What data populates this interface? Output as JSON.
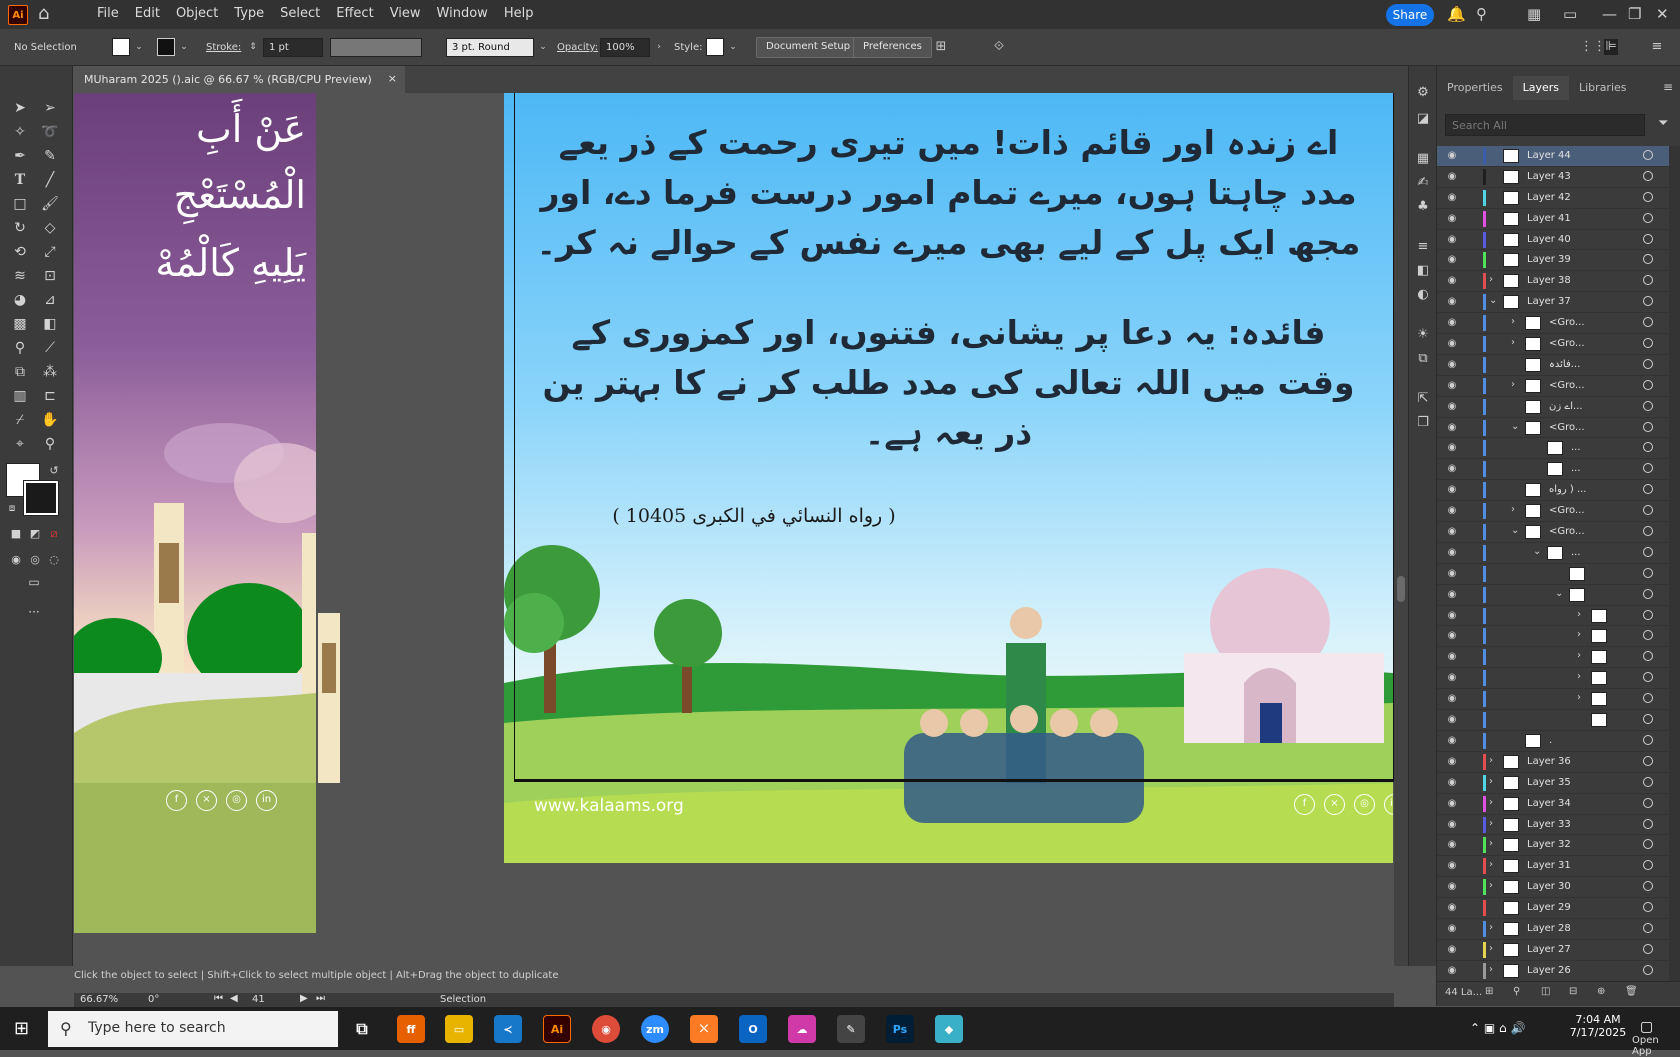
{
  "menubar": {
    "logo": "Ai",
    "menus": [
      "File",
      "Edit",
      "Object",
      "Type",
      "Select",
      "Effect",
      "View",
      "Window",
      "Help"
    ],
    "share": "Share"
  },
  "control": {
    "selection": "No Selection",
    "stroke_label": "Stroke:",
    "stroke_value": "1 pt",
    "brush": "3 pt. Round",
    "opacity_label": "Opacity:",
    "opacity_value": "100%",
    "style_label": "Style:",
    "document_setup": "Document Setup",
    "preferences": "Preferences"
  },
  "doc_tab": {
    "title": "MUharam 2025 ().aic @ 66.67 % (RGB/CPU Preview)",
    "close": "×"
  },
  "artboard_left": {
    "lines": [
      "عَنْ أَبِ",
      "الْمُسْتَعْجِ",
      "يَلِيهِ كَالْمُهْ"
    ]
  },
  "artboard_main": {
    "urdu_1": [
      "اے زندہ اور قائم ذات! میں تیری رحمت کے ذر یعے",
      "مدد چاہتا ہوں، میرے تمام امور درست فرما دے، اور",
      "مجھ ایک پل کے لیے بھی میرے نفس کے حوالے نہ کر۔"
    ],
    "urdu_2": [
      "فائدہ: یہ دعا پر یشانی، فتنوں، اور کمزوری کے",
      "وقت میں اللہ تعالی کی مدد طلب کر نے کا بہتر ین",
      "ذر یعہ ہے۔"
    ],
    "reference": "( رواه النسائي في الكبرى 10405 )",
    "website": "www.kalaams.org"
  },
  "social": [
    "f",
    "×",
    "◎",
    "in"
  ],
  "panel": {
    "tabs": [
      "Properties",
      "Layers",
      "Libraries"
    ],
    "search_placeholder": "Search All",
    "footer_count": "44 La..."
  },
  "layers": [
    {
      "name": "Layer 44",
      "color": "#3a5dae",
      "indent": 0,
      "arrow": "",
      "sel": true
    },
    {
      "name": "Layer 43",
      "color": "#1f1f1f",
      "indent": 0,
      "arrow": ""
    },
    {
      "name": "Layer 42",
      "color": "#4fd5e3",
      "indent": 0,
      "arrow": ""
    },
    {
      "name": "Layer 41",
      "color": "#e24fe3",
      "indent": 0,
      "arrow": ""
    },
    {
      "name": "Layer 40",
      "color": "#5a5ae3",
      "indent": 0,
      "arrow": ""
    },
    {
      "name": "Layer 39",
      "color": "#4fe35a",
      "indent": 0,
      "arrow": ""
    },
    {
      "name": "Layer 38",
      "color": "#e34f4f",
      "indent": 0,
      "arrow": "›"
    },
    {
      "name": "Layer 37",
      "color": "#4f8ee3",
      "indent": 0,
      "arrow": "⌄"
    },
    {
      "name": "<Gro...",
      "color": "#4f8ee3",
      "indent": 1,
      "arrow": "›"
    },
    {
      "name": "<Gro...",
      "color": "#4f8ee3",
      "indent": 1,
      "arrow": "›"
    },
    {
      "name": "فائدہ...",
      "color": "#4f8ee3",
      "indent": 1,
      "arrow": ""
    },
    {
      "name": "<Gro...",
      "color": "#4f8ee3",
      "indent": 1,
      "arrow": "›"
    },
    {
      "name": "اے زن...",
      "color": "#4f8ee3",
      "indent": 1,
      "arrow": ""
    },
    {
      "name": "<Gro...",
      "color": "#4f8ee3",
      "indent": 1,
      "arrow": "⌄"
    },
    {
      "name": "...",
      "color": "#4f8ee3",
      "indent": 2,
      "arrow": ""
    },
    {
      "name": "...",
      "color": "#4f8ee3",
      "indent": 2,
      "arrow": ""
    },
    {
      "name": "رواه ) ...",
      "color": "#4f8ee3",
      "indent": 1,
      "arrow": ""
    },
    {
      "name": "<Gro...",
      "color": "#4f8ee3",
      "indent": 1,
      "arrow": "›"
    },
    {
      "name": "<Gro...",
      "color": "#4f8ee3",
      "indent": 1,
      "arrow": "⌄"
    },
    {
      "name": "...",
      "color": "#4f8ee3",
      "indent": 2,
      "arrow": "⌄"
    },
    {
      "name": "",
      "color": "#4f8ee3",
      "indent": 3,
      "arrow": ""
    },
    {
      "name": "",
      "color": "#4f8ee3",
      "indent": 3,
      "arrow": "⌄"
    },
    {
      "name": "",
      "color": "#4f8ee3",
      "indent": 4,
      "arrow": "›"
    },
    {
      "name": "",
      "color": "#4f8ee3",
      "indent": 4,
      "arrow": "›"
    },
    {
      "name": "",
      "color": "#4f8ee3",
      "indent": 4,
      "arrow": "›"
    },
    {
      "name": "",
      "color": "#4f8ee3",
      "indent": 4,
      "arrow": "›"
    },
    {
      "name": "",
      "color": "#4f8ee3",
      "indent": 4,
      "arrow": "›"
    },
    {
      "name": "",
      "color": "#4f8ee3",
      "indent": 4,
      "arrow": ""
    },
    {
      "name": ".",
      "color": "#4f8ee3",
      "indent": 1,
      "arrow": ""
    },
    {
      "name": "Layer 36",
      "color": "#e34f4f",
      "indent": 0,
      "arrow": "›"
    },
    {
      "name": "Layer 35",
      "color": "#4fd5e3",
      "indent": 0,
      "arrow": "›"
    },
    {
      "name": "Layer 34",
      "color": "#e24fe3",
      "indent": 0,
      "arrow": "›"
    },
    {
      "name": "Layer 33",
      "color": "#5a5ae3",
      "indent": 0,
      "arrow": "›"
    },
    {
      "name": "Layer 32",
      "color": "#4fe35a",
      "indent": 0,
      "arrow": "›"
    },
    {
      "name": "Layer 31",
      "color": "#e34f4f",
      "indent": 0,
      "arrow": "›"
    },
    {
      "name": "Layer 30",
      "color": "#4fe35a",
      "indent": 0,
      "arrow": "›"
    },
    {
      "name": "Layer 29",
      "color": "#e34f4f",
      "indent": 0,
      "arrow": ""
    },
    {
      "name": "Layer 28",
      "color": "#4f8ee3",
      "indent": 0,
      "arrow": "›"
    },
    {
      "name": "Layer 27",
      "color": "#e3d54f",
      "indent": 0,
      "arrow": "›"
    },
    {
      "name": "Layer 26",
      "color": "#9a9a9a",
      "indent": 0,
      "arrow": "›"
    }
  ],
  "status": {
    "hint": "Click the object to select | Shift+Click to select multiple object | Alt+Drag the object to duplicate",
    "zoom": "66.67%",
    "rotation": "0°",
    "artboard_num": "41",
    "tool": "Selection"
  },
  "taskbar": {
    "search_placeholder": "Type here to search",
    "time": "7:04 AM",
    "date": "7/17/2025",
    "open_app": "Open App"
  }
}
